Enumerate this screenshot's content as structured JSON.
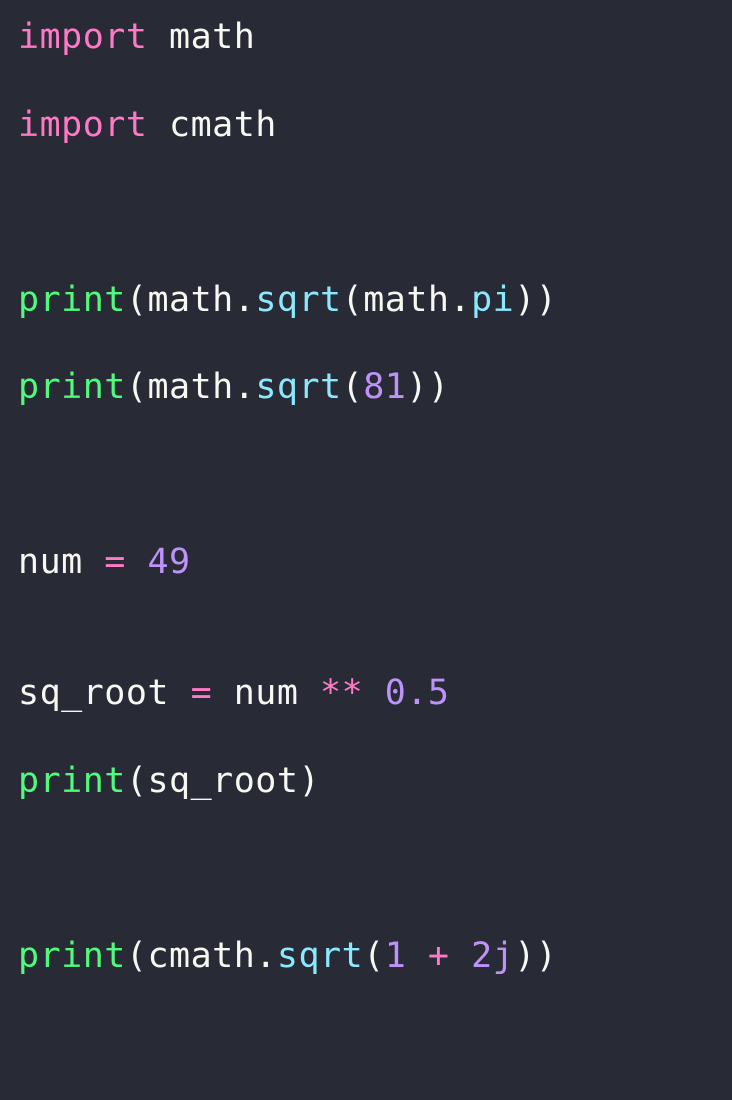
{
  "colors": {
    "bg": "#282a36",
    "default": "#f8f8f2",
    "keyword": "#ff79c6",
    "builtin": "#50fa7b",
    "method": "#8be9fd",
    "number": "#bd93f9",
    "operator": "#ff79c6",
    "paren": "#f8f8f2"
  },
  "lines": [
    [
      {
        "t": "import",
        "c": "keyword"
      },
      {
        "t": " math",
        "c": "default"
      }
    ],
    [],
    [
      {
        "t": "import",
        "c": "keyword"
      },
      {
        "t": " cmath",
        "c": "default"
      }
    ],
    [],
    [],
    [],
    [
      {
        "t": "print",
        "c": "builtin"
      },
      {
        "t": "(",
        "c": "paren"
      },
      {
        "t": "math",
        "c": "default"
      },
      {
        "t": ".",
        "c": "default"
      },
      {
        "t": "sqrt",
        "c": "method"
      },
      {
        "t": "(",
        "c": "paren"
      },
      {
        "t": "math",
        "c": "default"
      },
      {
        "t": ".",
        "c": "default"
      },
      {
        "t": "pi",
        "c": "method"
      },
      {
        "t": "))",
        "c": "paren"
      }
    ],
    [],
    [
      {
        "t": "print",
        "c": "builtin"
      },
      {
        "t": "(",
        "c": "paren"
      },
      {
        "t": "math",
        "c": "default"
      },
      {
        "t": ".",
        "c": "default"
      },
      {
        "t": "sqrt",
        "c": "method"
      },
      {
        "t": "(",
        "c": "paren"
      },
      {
        "t": "81",
        "c": "number"
      },
      {
        "t": "))",
        "c": "paren"
      }
    ],
    [],
    [],
    [],
    [
      {
        "t": "num ",
        "c": "default"
      },
      {
        "t": "=",
        "c": "operator"
      },
      {
        "t": " ",
        "c": "default"
      },
      {
        "t": "49",
        "c": "number"
      }
    ],
    [],
    [],
    [
      {
        "t": "sq_root ",
        "c": "default"
      },
      {
        "t": "=",
        "c": "operator"
      },
      {
        "t": " num ",
        "c": "default"
      },
      {
        "t": "**",
        "c": "operator"
      },
      {
        "t": " ",
        "c": "default"
      },
      {
        "t": "0.5",
        "c": "number"
      }
    ],
    [],
    [
      {
        "t": "print",
        "c": "builtin"
      },
      {
        "t": "(",
        "c": "paren"
      },
      {
        "t": "sq_root",
        "c": "default"
      },
      {
        "t": ")",
        "c": "paren"
      }
    ],
    [],
    [],
    [],
    [
      {
        "t": "print",
        "c": "builtin"
      },
      {
        "t": "(",
        "c": "paren"
      },
      {
        "t": "cmath",
        "c": "default"
      },
      {
        "t": ".",
        "c": "default"
      },
      {
        "t": "sqrt",
        "c": "method"
      },
      {
        "t": "(",
        "c": "paren"
      },
      {
        "t": "1",
        "c": "number"
      },
      {
        "t": " ",
        "c": "default"
      },
      {
        "t": "+",
        "c": "operator"
      },
      {
        "t": " ",
        "c": "default"
      },
      {
        "t": "2j",
        "c": "number"
      },
      {
        "t": "))",
        "c": "paren"
      }
    ]
  ]
}
